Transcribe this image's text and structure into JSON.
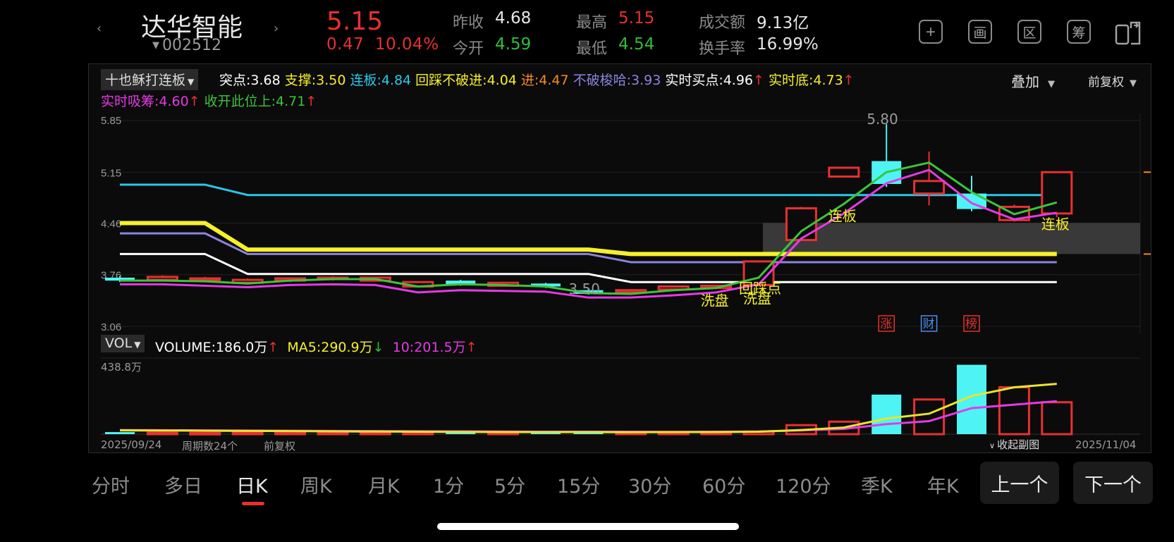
{
  "header": {
    "name": "达华智能",
    "code": "002512",
    "price": "5.15",
    "change": "0.47",
    "change_pct": "10.04%",
    "quotes": [
      {
        "label": "昨收",
        "value": "4.68",
        "color": "#e6e6e6"
      },
      {
        "label": "今开",
        "value": "4.59",
        "color": "#2bbf3a"
      },
      {
        "label": "最高",
        "value": "5.15",
        "color": "#e83030"
      },
      {
        "label": "最低",
        "value": "4.54",
        "color": "#2bbf3a"
      },
      {
        "label": "成交额",
        "value": "9.13亿",
        "color": "#e6e6e6"
      },
      {
        "label": "换手率",
        "value": "16.99%",
        "color": "#e6e6e6"
      }
    ],
    "tools": [
      "+",
      "画",
      "区",
      "筹",
      "split-screen-icon"
    ]
  },
  "indicator": {
    "selector": "十也稣打连板",
    "line1": [
      {
        "label": "突点:",
        "value": "3.68",
        "color": "#ffffff",
        "arrow": ""
      },
      {
        "label": "支撑:",
        "value": "3.50",
        "color": "#f6f02a",
        "arrow": ""
      },
      {
        "label": "连板:",
        "value": "4.84",
        "color": "#2bc7e8",
        "arrow": ""
      },
      {
        "label": "回踩不破进:",
        "value": "4.04",
        "color": "#f6f02a",
        "arrow": ""
      },
      {
        "label": "进:",
        "value": "4.47",
        "color": "#f28a24",
        "arrow": ""
      },
      {
        "label": "不破梭哈:",
        "value": "3.93",
        "color": "#8b84e0",
        "arrow": ""
      },
      {
        "label": "实时买点:",
        "value": "4.96",
        "color": "#ffffff",
        "arrow": "↑"
      },
      {
        "label": "实时底:",
        "value": "4.73",
        "color": "#f6f02a",
        "arrow": "↑"
      }
    ],
    "line2": [
      {
        "label": "实时吸筹:",
        "value": "4.60",
        "color": "#e53ae5",
        "arrow": "↑"
      },
      {
        "label": "收开此位上:",
        "value": "4.71",
        "color": "#3cc43c",
        "arrow": "↑"
      }
    ],
    "overlay": "叠加",
    "adjust": "前复权"
  },
  "chart_data": {
    "type": "candlestick",
    "yticks": [
      "5.85",
      "5.15",
      "4.46",
      "3.76",
      "3.06"
    ],
    "ylim": [
      3.06,
      5.85
    ],
    "candles": [
      {
        "o": 3.72,
        "c": 3.68,
        "h": 3.74,
        "l": 3.66
      },
      {
        "o": 3.69,
        "c": 3.73,
        "h": 3.75,
        "l": 3.68
      },
      {
        "o": 3.7,
        "c": 3.71,
        "h": 3.73,
        "l": 3.67
      },
      {
        "o": 3.65,
        "c": 3.69,
        "h": 3.71,
        "l": 3.64
      },
      {
        "o": 3.68,
        "c": 3.71,
        "h": 3.72,
        "l": 3.66
      },
      {
        "o": 3.7,
        "c": 3.72,
        "h": 3.74,
        "l": 3.68
      },
      {
        "o": 3.68,
        "c": 3.72,
        "h": 3.73,
        "l": 3.67
      },
      {
        "o": 3.6,
        "c": 3.66,
        "h": 3.67,
        "l": 3.59
      },
      {
        "o": 3.68,
        "c": 3.63,
        "h": 3.69,
        "l": 3.61
      },
      {
        "o": 3.61,
        "c": 3.65,
        "h": 3.66,
        "l": 3.6
      },
      {
        "o": 3.64,
        "c": 3.6,
        "h": 3.65,
        "l": 3.58
      },
      {
        "o": 3.55,
        "c": 3.5,
        "h": 3.56,
        "l": 3.49
      },
      {
        "o": 3.52,
        "c": 3.55,
        "h": 3.56,
        "l": 3.5
      },
      {
        "o": 3.56,
        "c": 3.6,
        "h": 3.61,
        "l": 3.55
      },
      {
        "o": 3.58,
        "c": 3.61,
        "h": 3.62,
        "l": 3.57
      },
      {
        "o": 3.62,
        "c": 3.94,
        "h": 3.95,
        "l": 3.62
      },
      {
        "o": 4.23,
        "c": 4.66,
        "h": 4.68,
        "l": 4.22
      },
      {
        "o": 5.09,
        "c": 5.21,
        "h": 5.22,
        "l": 5.08
      },
      {
        "o": 5.3,
        "c": 4.99,
        "h": 5.8,
        "l": 4.95
      },
      {
        "o": 4.86,
        "c": 5.03,
        "h": 5.43,
        "l": 4.7
      },
      {
        "o": 4.86,
        "c": 4.65,
        "h": 5.1,
        "l": 4.62
      },
      {
        "o": 4.5,
        "c": 4.68,
        "h": 4.71,
        "l": 4.48
      },
      {
        "o": 4.59,
        "c": 5.15,
        "h": 5.15,
        "l": 4.54
      }
    ],
    "cyan_line": [
      4.98,
      4.98,
      4.98,
      4.84,
      4.84,
      4.84,
      4.84,
      4.84,
      4.84,
      4.84,
      4.84,
      4.84,
      4.84,
      4.84,
      4.84,
      4.84,
      4.84,
      4.84,
      4.84,
      4.84,
      4.84,
      4.84,
      4.84
    ],
    "yellow_line": [
      4.46,
      4.46,
      4.46,
      4.1,
      4.1,
      4.1,
      4.1,
      4.1,
      4.1,
      4.1,
      4.1,
      4.1,
      4.04,
      4.04,
      4.04,
      4.04,
      4.04,
      4.04,
      4.04,
      4.04,
      4.04,
      4.04,
      4.04
    ],
    "purple_line": [
      4.32,
      4.32,
      4.32,
      4.04,
      4.04,
      4.04,
      4.04,
      4.04,
      4.04,
      4.04,
      4.04,
      4.04,
      3.93,
      3.93,
      3.93,
      3.93,
      3.93,
      3.93,
      3.93,
      3.93,
      3.93,
      3.93,
      3.93
    ],
    "white_line": [
      4.04,
      4.04,
      4.04,
      3.77,
      3.77,
      3.77,
      3.77,
      3.77,
      3.77,
      3.77,
      3.77,
      3.77,
      3.66,
      3.66,
      3.66,
      3.66,
      3.66,
      3.66,
      3.66,
      3.66,
      3.66,
      3.66,
      3.66
    ],
    "green_line": [
      3.68,
      3.68,
      3.67,
      3.64,
      3.68,
      3.7,
      3.7,
      3.6,
      3.63,
      3.62,
      3.6,
      3.51,
      3.5,
      3.55,
      3.58,
      3.72,
      4.35,
      4.72,
      5.15,
      5.28,
      4.88,
      4.58,
      4.74
    ],
    "magenta_line": [
      3.63,
      3.63,
      3.61,
      3.59,
      3.62,
      3.63,
      3.62,
      3.52,
      3.55,
      3.54,
      3.53,
      3.45,
      3.45,
      3.48,
      3.52,
      3.63,
      4.25,
      4.59,
      5.0,
      5.18,
      4.73,
      4.51,
      4.6
    ],
    "labels": [
      {
        "text": "5.80",
        "i": 18,
        "y": 5.8,
        "color": "#9a9a9a"
      },
      {
        "text": "3.50",
        "i": 11,
        "y": 3.5,
        "color": "#9a9a9a"
      },
      {
        "text": "洗盘",
        "i": 14,
        "y": 3.34,
        "color": "#f6f02a"
      },
      {
        "text": "回踩点",
        "i": 15,
        "y": 3.51,
        "color": "#f6f02a"
      },
      {
        "text": "洗盘",
        "i": 15,
        "y": 3.37,
        "color": "#f6f02a"
      },
      {
        "text": "连板",
        "i": 17,
        "y": 4.49,
        "color": "#f6f02a"
      },
      {
        "text": "连板",
        "i": 22,
        "y": 4.38,
        "color": "#f6f02a"
      }
    ],
    "badges": [
      {
        "text": "涨",
        "i": 18,
        "color": "#e83030"
      },
      {
        "text": "财",
        "i": 19,
        "color": "#4a8ef0"
      },
      {
        "text": "榜",
        "i": 20,
        "color": "#e83030"
      }
    ]
  },
  "volume": {
    "selector": "VOL",
    "vol_label": "VOLUME:",
    "vol_value": "186.0万",
    "vol_arrow": "↑",
    "ma5_label": "MA5:",
    "ma5_value": "290.9万",
    "ma5_arrow": "↓",
    "ma10_label": "10:",
    "ma10_value": "201.5万",
    "ma10_arrow": "↑",
    "max_label": "438.8万",
    "max": 438.8,
    "values": [
      12,
      8,
      7,
      12,
      10,
      8,
      10,
      10,
      11,
      10,
      10,
      12,
      10,
      12,
      14,
      15,
      52,
      72,
      228,
      200,
      400,
      270,
      184,
      186
    ],
    "ma5": [
      22,
      21,
      20,
      19,
      18,
      16,
      15,
      14,
      13,
      12,
      12,
      12,
      11,
      12,
      12,
      14,
      24,
      38,
      90,
      118,
      220,
      270,
      290,
      290.9
    ],
    "ma10": [
      24,
      23,
      22,
      21,
      20,
      19,
      18,
      17,
      16,
      15,
      14,
      14,
      14,
      13,
      14,
      15,
      22,
      30,
      58,
      75,
      150,
      170,
      190,
      201.5
    ]
  },
  "footer": {
    "start_date": "2025/09/24",
    "period_count": "周期数24个",
    "adjust": "前复权",
    "collapse": "收起副图",
    "end_date": "2025/11/04"
  },
  "periods": [
    "分时",
    "多日",
    "日K",
    "周K",
    "月K",
    "1分",
    "5分",
    "15分",
    "30分",
    "60分",
    "120分",
    "季K",
    "年K"
  ],
  "active_period": "日K",
  "prev": "上一个",
  "next": "下一个"
}
